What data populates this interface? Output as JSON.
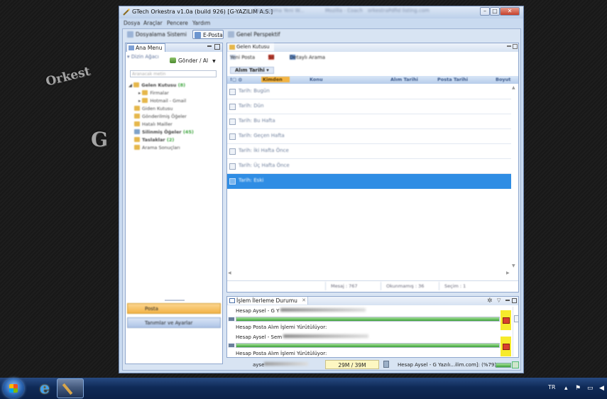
{
  "window": {
    "title": "GTech Orkestra v1.0a (build 926) [G-YAZILIM A.S.]",
    "ghost_tabs": [
      "Dosyalama Yeni W...",
      "Mozilla - Coach",
      "orkestraPdfid listing.com",
      "GTech Orkestra..."
    ]
  },
  "menubar": [
    "Dosya",
    "Araçlar",
    "Pencere",
    "Yardım"
  ],
  "perspectives": [
    "Dosyalama Sistemi",
    "E-Posta",
    "Genel Perspektif"
  ],
  "left_panel": {
    "tab": "Ana Menu",
    "section": "Dizin Ağacı",
    "send_button": "Gönder / Al",
    "search_placeholder": "Aranacak metin",
    "tree": [
      {
        "label": "Gelen Kutusu",
        "count": "(8)"
      },
      {
        "label": "Firmalar",
        "count": ""
      },
      {
        "label": "Hotmail - Gmail",
        "count": ""
      },
      {
        "label": "Giden Kutusu",
        "count": ""
      },
      {
        "label": "Gönderilmiş Öğeler",
        "count": ""
      },
      {
        "label": "Hatalı Mailler",
        "count": ""
      },
      {
        "label": "Silinmiş Öğeler",
        "count": "(45)"
      },
      {
        "label": "Taslaklar",
        "count": "(2)"
      },
      {
        "label": "Arama Sonuçları",
        "count": ""
      }
    ],
    "bottom_buttons": [
      "Posta",
      "Tanımlar ve Ayarlar"
    ]
  },
  "mail_panel": {
    "tab": "Gelen Kutusu",
    "toolbar": {
      "new_mail": "Yeni Posta",
      "delete": "Sil",
      "detailed_search": "Detaylı Arama"
    },
    "sort_field": "Alım Tarihi",
    "columns": [
      "Kimden",
      "Konu",
      "Alım Tarihi",
      "Posta Tarihi",
      "Boyut"
    ],
    "groups": [
      "Tarih: Bugün",
      "Tarih: Dün",
      "Tarih: Bu Hafta",
      "Tarih: Geçen Hafta",
      "Tarih: İki Hafta Önce",
      "Tarih: Üç Hafta Önce",
      "Tarih: Eski"
    ],
    "selected_group_index": 6,
    "status": {
      "messages": "Mesaj : 767",
      "unread": "Okunmamış : 36",
      "selection": "Seçim : 1"
    }
  },
  "progress_panel": {
    "tab": "İşlem İlerleme Durumu",
    "jobs": [
      {
        "account": "Hesap Aysel - G Y",
        "message": "Hesap Posta Alım İşlemi Yürütülüyor:",
        "progress": 1.0
      },
      {
        "account": "Hesap Aysel - Sem",
        "message": "Hesap Posta Alım İşlemi Yürütülüyor:",
        "progress": 1.0
      }
    ]
  },
  "statusbar": {
    "user": "ayse",
    "memory": "29M / 39M",
    "account_progress": "Hesap Aysel - G Yazılı...ilim.com]: (%79)"
  },
  "desktop": {
    "watermark_1": "Orkest",
    "watermark_2": "G"
  },
  "taskbar": {
    "lang": "TR"
  },
  "colors": {
    "selection": "#2f8de4",
    "accent_orange": "#f3b443",
    "progress_green": "#3ea13a",
    "stop_yellow": "#f6ea2c"
  }
}
